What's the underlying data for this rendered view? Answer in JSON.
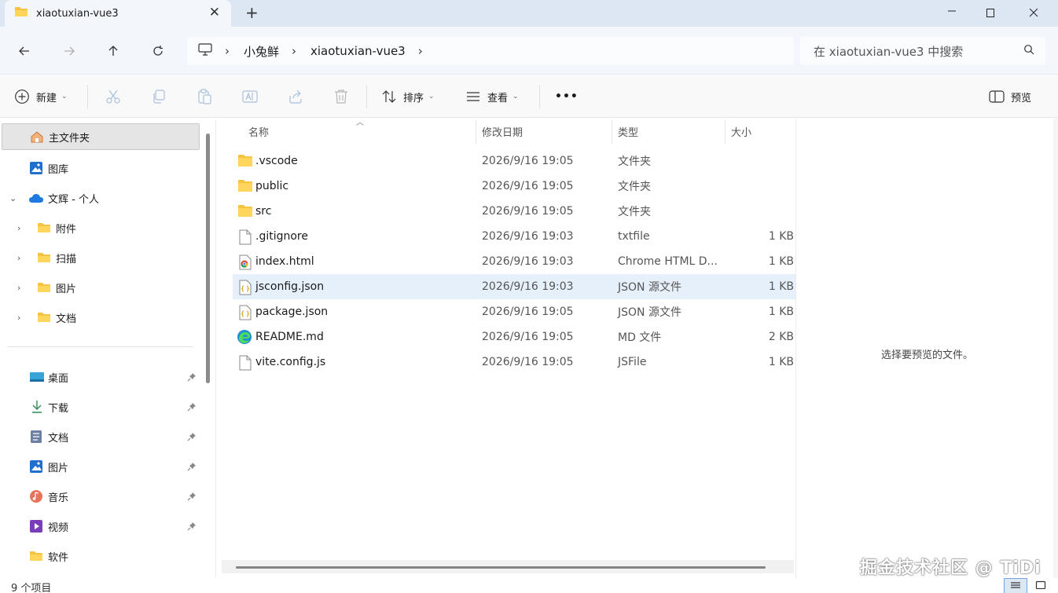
{
  "tab": {
    "title": "xiaotuxian-vue3",
    "close": "✕",
    "new": "+"
  },
  "address": {
    "crumbs": [
      "小兔鲜",
      "xiaotuxian-vue3"
    ]
  },
  "search": {
    "placeholder": "在 xiaotuxian-vue3 中搜索"
  },
  "toolbar": {
    "new_label": "新建",
    "sort_label": "排序",
    "view_label": "查看",
    "more_label": "•••",
    "preview_label": "预览"
  },
  "sidebar": {
    "home": "主文件夹",
    "gallery": "图库",
    "onedrive": "文辉 - 个人",
    "onedrive_children": [
      "附件",
      "扫描",
      "图片",
      "文档"
    ],
    "quick_access": [
      "桌面",
      "下载",
      "文档",
      "图片",
      "音乐",
      "视频",
      "软件"
    ]
  },
  "columns": {
    "name": "名称",
    "date": "修改日期",
    "type": "类型",
    "size": "大小"
  },
  "files": [
    {
      "name": ".vscode",
      "date": "2026/9/16 19:05",
      "type": "文件夹",
      "size": "",
      "icon": "folder-icon"
    },
    {
      "name": "public",
      "date": "2026/9/16 19:05",
      "type": "文件夹",
      "size": "",
      "icon": "folder-icon"
    },
    {
      "name": "src",
      "date": "2026/9/16 19:05",
      "type": "文件夹",
      "size": "",
      "icon": "folder-icon"
    },
    {
      "name": ".gitignore",
      "date": "2026/9/16 19:03",
      "type": "txtfile",
      "size": "1 KB",
      "icon": "file-icon"
    },
    {
      "name": "index.html",
      "date": "2026/9/16 19:03",
      "type": "Chrome HTML D...",
      "size": "1 KB",
      "icon": "chrome-html-icon"
    },
    {
      "name": "jsconfig.json",
      "date": "2026/9/16 19:03",
      "type": "JSON 源文件",
      "size": "1 KB",
      "icon": "json-file-icon"
    },
    {
      "name": "package.json",
      "date": "2026/9/16 19:05",
      "type": "JSON 源文件",
      "size": "1 KB",
      "icon": "json-file-icon"
    },
    {
      "name": "README.md",
      "date": "2026/9/16 19:05",
      "type": "MD 文件",
      "size": "2 KB",
      "icon": "edge-md-icon"
    },
    {
      "name": "vite.config.js",
      "date": "2026/9/16 19:05",
      "type": "JSFile",
      "size": "1 KB",
      "icon": "file-icon"
    }
  ],
  "preview": {
    "message": "选择要预览的文件。"
  },
  "status": {
    "count": "9 个项目"
  },
  "watermark": "掘金技术社区 @ TiDi"
}
